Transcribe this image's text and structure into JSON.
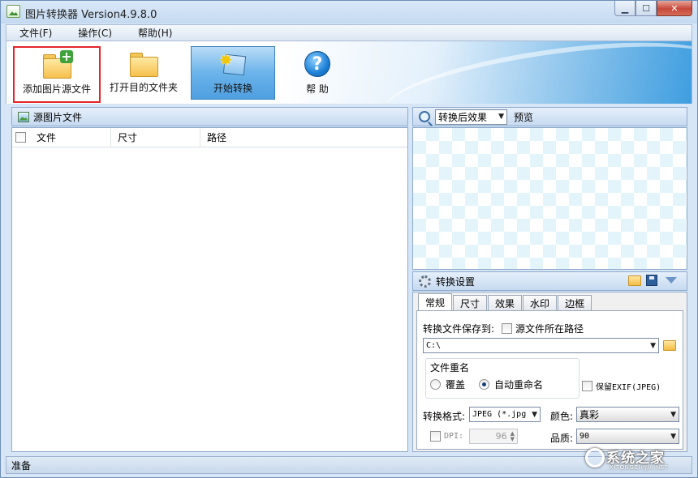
{
  "window": {
    "title": "图片转换器 Version4.9.8.0",
    "controls": {
      "minimize": "▁",
      "maximize": "☐",
      "close": "✕"
    }
  },
  "menu": [
    "文件(F)",
    "操作(C)",
    "帮助(H)"
  ],
  "toolbar": {
    "add_source": "添加图片源文件",
    "open_target_folder": "打开目的文件夹",
    "start_convert": "开始转换",
    "help": "帮 助"
  },
  "source_panel": {
    "title": "源图片文件",
    "columns": [
      "文件",
      "尺寸",
      "路径"
    ],
    "rows": []
  },
  "preview_panel": {
    "mode_selected": "转换后效果",
    "label": "预览"
  },
  "settings": {
    "title": "转换设置",
    "tabs": [
      "常规",
      "尺寸",
      "效果",
      "水印",
      "边框"
    ],
    "active_tab": "常规",
    "save_to_label": "转换文件保存到:",
    "source_path_checkbox": "源文件所在路径",
    "save_path_value": "C:\\",
    "rename_group_label": "文件重名",
    "rename_overwrite": "覆盖",
    "rename_auto": "自动重命名",
    "rename_selected": "auto",
    "keep_exif": "保留EXIF(JPEG)",
    "format_label": "转换格式:",
    "format_value": "JPEG (*.jpg",
    "color_label": "颜色:",
    "color_value": "真彩",
    "dpi_label": "DPI:",
    "dpi_value": "96",
    "quality_label": "品质:",
    "quality_value": "90"
  },
  "status": "准备",
  "watermark": {
    "brand": "系统之家",
    "site": "XITONGZHIJIA.NET"
  }
}
